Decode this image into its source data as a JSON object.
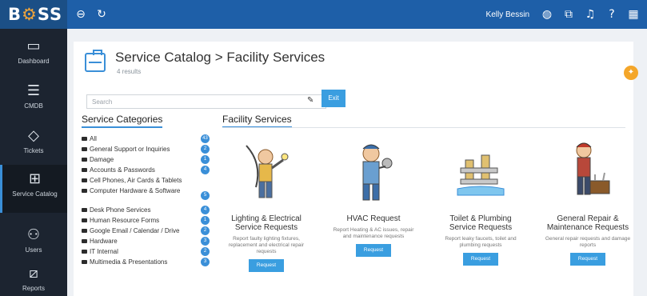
{
  "app": {
    "logo": "BOSS"
  },
  "topbar": {
    "user_name": "Kelly Bessin"
  },
  "sidebar": {
    "items": [
      {
        "label": "Dashboard",
        "icon": "monitor-icon"
      },
      {
        "label": "CMDB",
        "icon": "database-icon"
      },
      {
        "label": "Tickets",
        "icon": "tag-icon"
      },
      {
        "label": "Service Catalog",
        "icon": "briefcase-icon"
      },
      {
        "label": "Users",
        "icon": "users-icon"
      },
      {
        "label": "Reports",
        "icon": "chart-icon"
      }
    ]
  },
  "header": {
    "title": "Service Catalog > Facility Services",
    "subtitle": "4 results"
  },
  "search": {
    "placeholder": "Search",
    "go_label": "Exit"
  },
  "categories": {
    "title": "Service Categories",
    "items": [
      {
        "label": "All",
        "count": "43"
      },
      {
        "label": "General Support or Inquiries",
        "count": "2"
      },
      {
        "label": "Damage",
        "count": "1"
      },
      {
        "label": "Accounts & Passwords",
        "count": "4"
      },
      {
        "label": "Cell Phones, Air Cards & Tablets",
        "count": ""
      },
      {
        "label": "Computer Hardware & Software",
        "count": "5"
      },
      {
        "label": "Desk Phone Services",
        "count": "4"
      },
      {
        "label": "Human Resource Forms",
        "count": "1"
      },
      {
        "label": "Google Email / Calendar / Drive",
        "count": "2"
      },
      {
        "label": "Hardware",
        "count": "3"
      },
      {
        "label": "IT Internal",
        "count": "2"
      },
      {
        "label": "Multimedia & Presentations",
        "count": "3"
      }
    ]
  },
  "facility": {
    "title": "Facility Services",
    "services": [
      {
        "title": "Lighting & Electrical Service Requests",
        "desc": "Report faulty lighting fixtures, replacement and electrical repair requests",
        "button": "Request"
      },
      {
        "title": "HVAC Request",
        "desc": "Report Heating & AC issues, repair and maintenance requests",
        "button": "Request"
      },
      {
        "title": "Toilet & Plumbing Service Requests",
        "desc": "Report leaky faucets, toilet and plumbing requests",
        "button": "Request"
      },
      {
        "title": "General Repair & Maintenance Requests",
        "desc": "General repair requests and damage reports",
        "button": "Request"
      }
    ]
  },
  "colors": {
    "topbar": "#1e5fa8",
    "sidebar": "#1c2430",
    "accent": "#3a9ee0",
    "favorite": "#f4a62a"
  }
}
